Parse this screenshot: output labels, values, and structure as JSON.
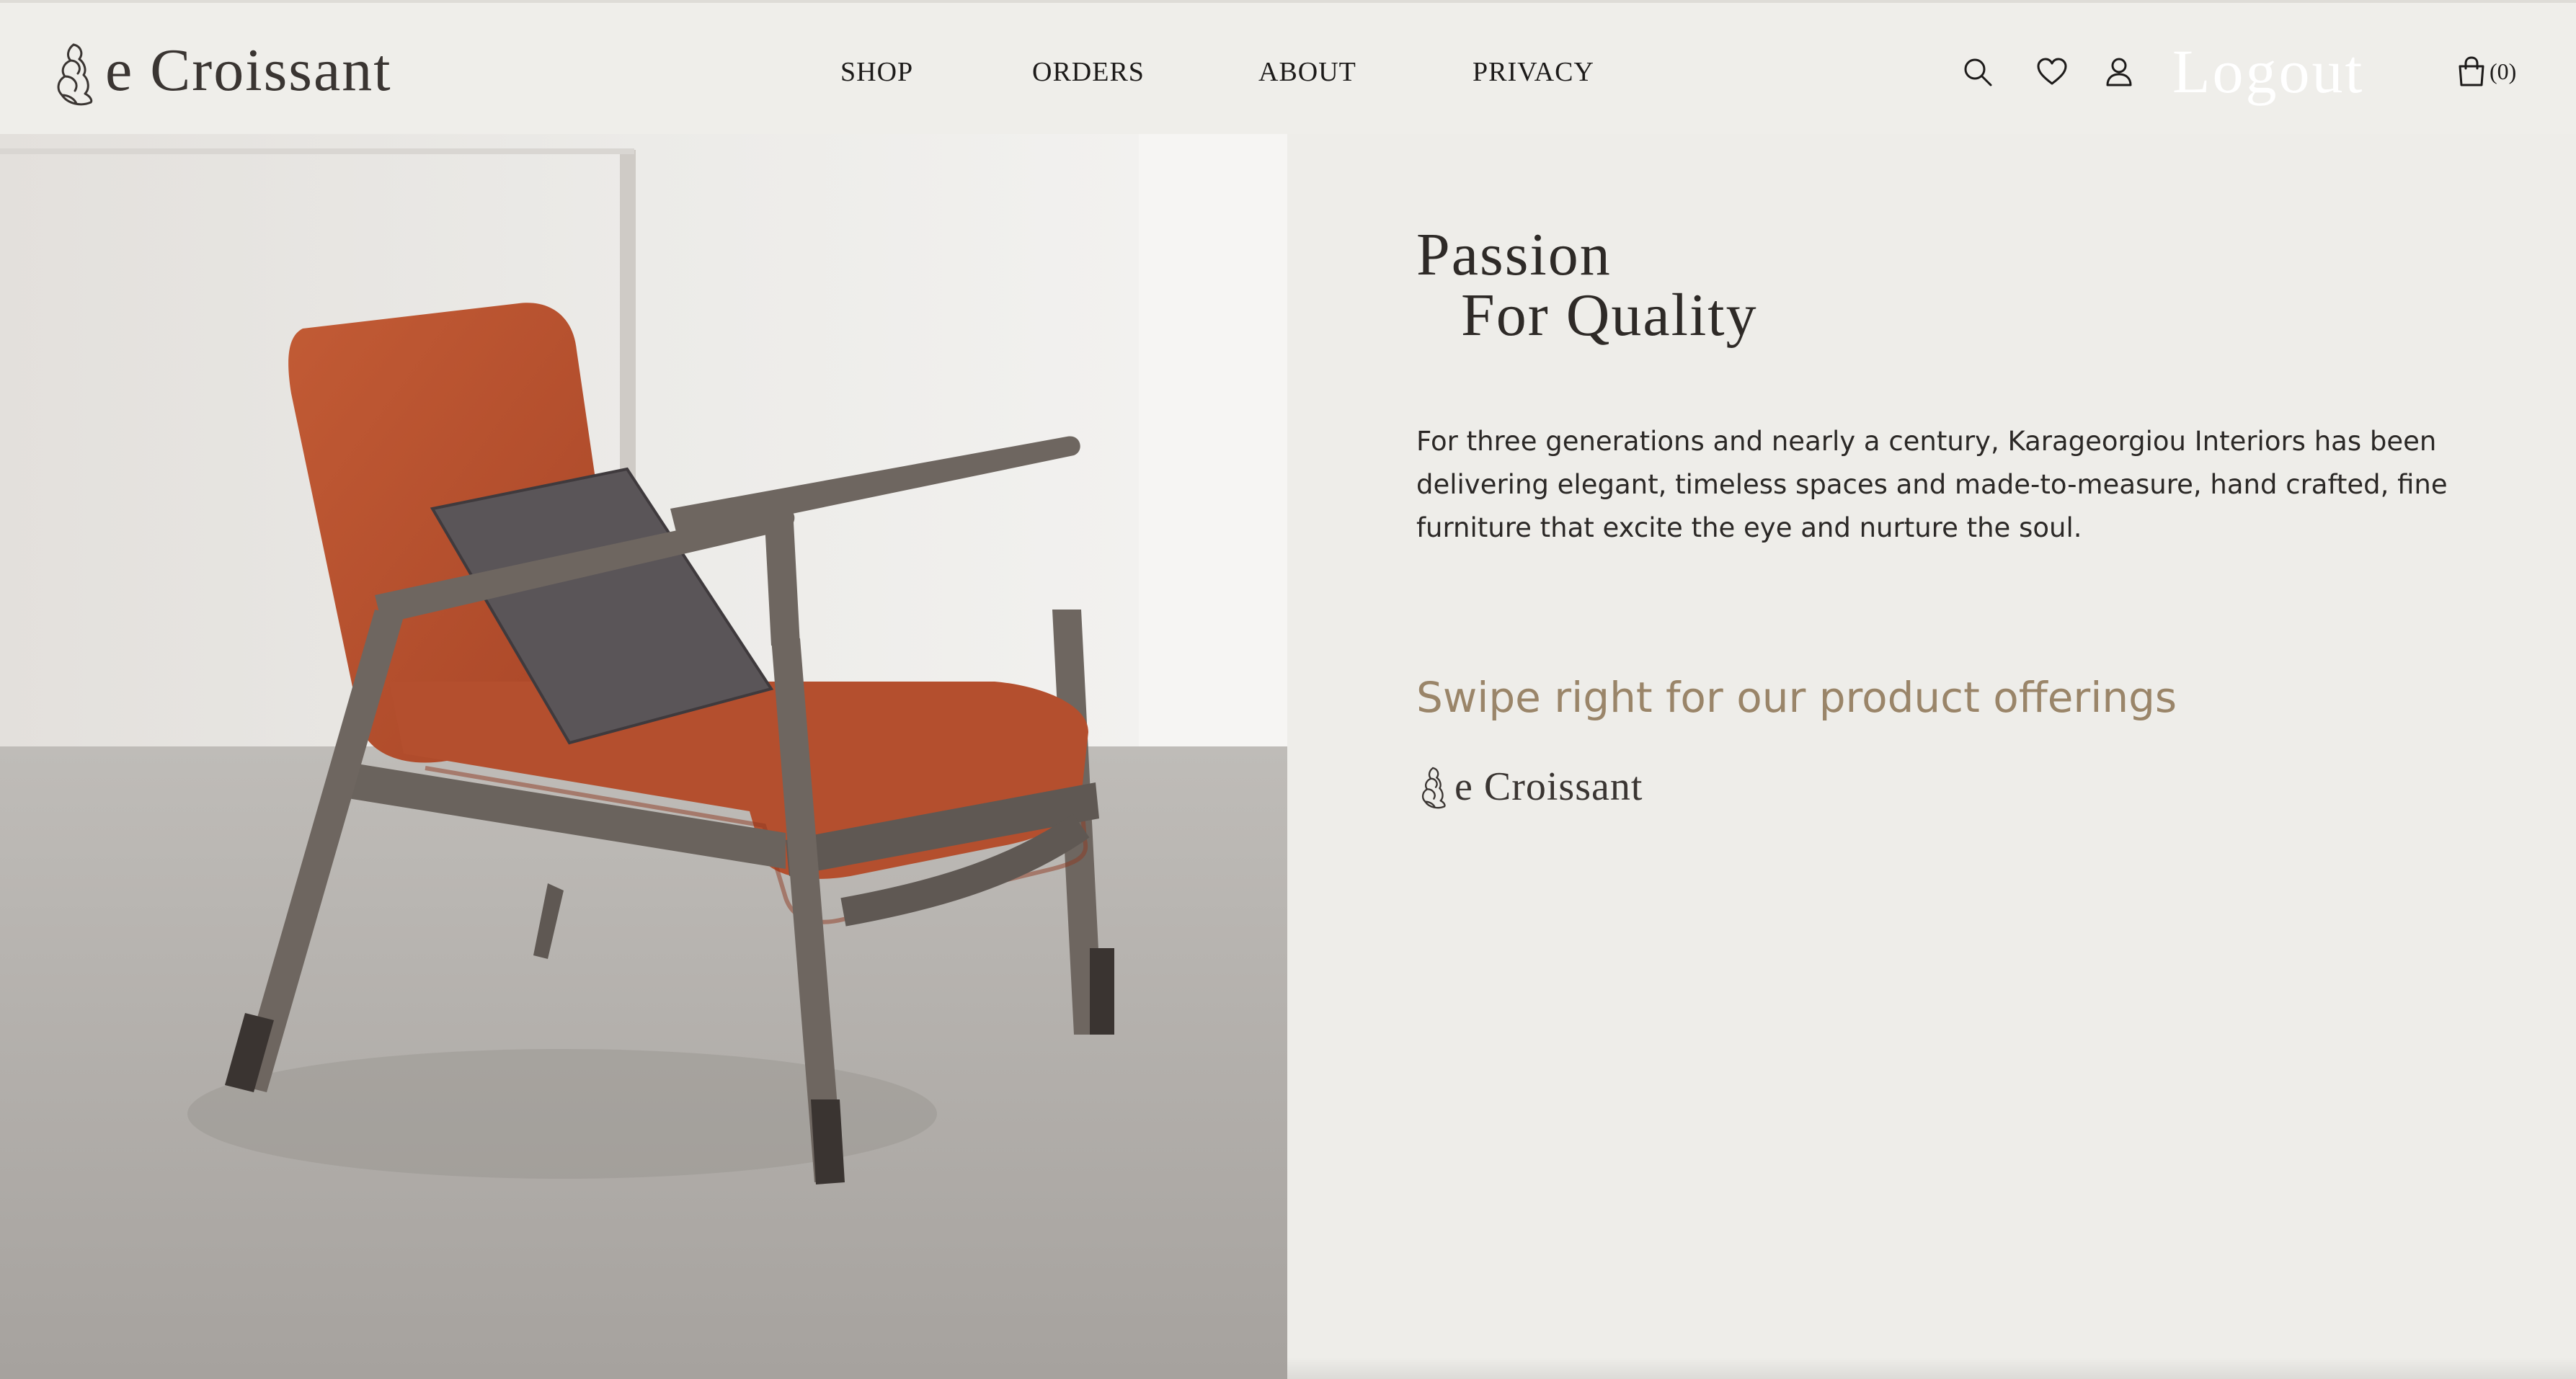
{
  "brand": {
    "logo_text": "e Croissant",
    "logo_icon": "croissant-icon"
  },
  "nav": {
    "items": [
      {
        "label": "SHOP"
      },
      {
        "label": "ORDERS"
      },
      {
        "label": "ABOUT"
      },
      {
        "label": "PRIVACY"
      }
    ]
  },
  "header_actions": {
    "icons": [
      "search-icon",
      "heart-icon",
      "user-icon",
      "shopping-bag-icon"
    ],
    "logout_label": "Logout",
    "cart_count": "(0)"
  },
  "hero": {
    "image": "armchair-photo",
    "title_line1": "Passion",
    "title_line2": "For Quality",
    "description": "For three generations and nearly a century, Karageorgiou Interiors has been delivering elegant, timeless spaces and made-to-measure, hand crafted, fine furniture that excite the eye and nurture the soul.",
    "swipe_text": "Swipe right for our product offerings",
    "footer_logo_text": "e Croissant"
  },
  "colors": {
    "background": "#eeede9",
    "accent_text": "#9a8569",
    "dark_text": "#2a2624",
    "chair_upholstery": "#b5502e",
    "chair_frame": "#6e6660"
  }
}
